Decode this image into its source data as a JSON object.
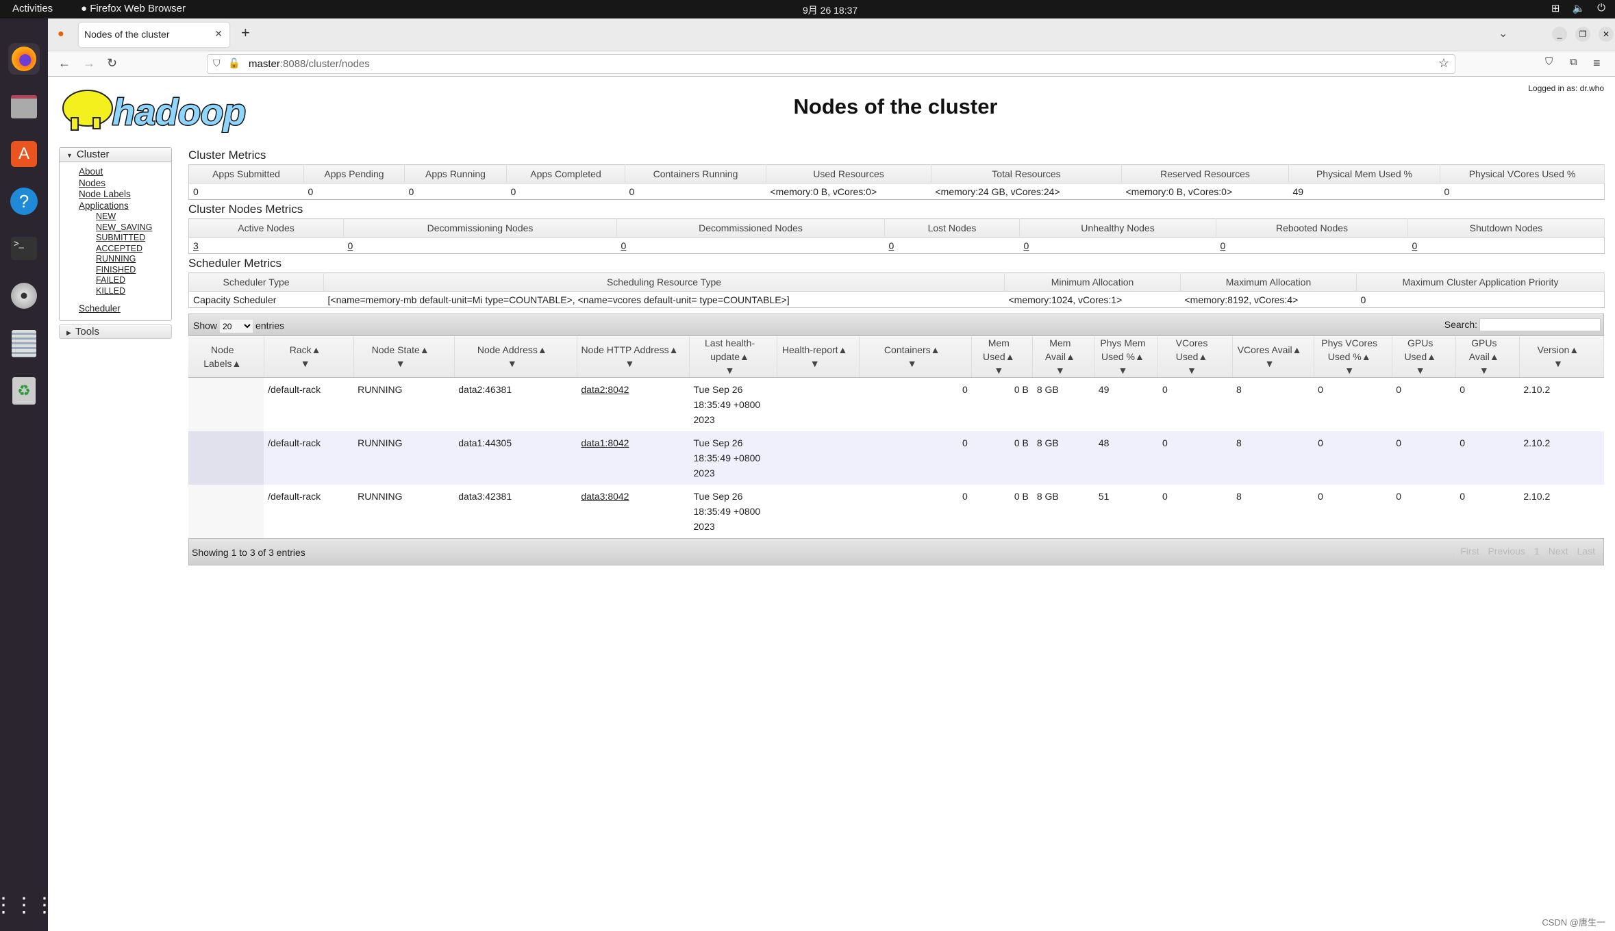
{
  "topbar": {
    "activities": "Activities",
    "app": "Firefox Web Browser",
    "clock": "9月 26  18:37"
  },
  "browser": {
    "tab_title": "Nodes of the cluster",
    "url_host": "master",
    "url_path": ":8088/cluster/nodes"
  },
  "page": {
    "title": "Nodes of the cluster",
    "logged_in": "Logged in as: dr.who",
    "logo_text": "hadoop"
  },
  "sidebar": {
    "cluster": "Cluster",
    "links": [
      "About",
      "Nodes",
      "Node Labels",
      "Applications"
    ],
    "app_states": [
      "NEW",
      "NEW_SAVING",
      "SUBMITTED",
      "ACCEPTED",
      "RUNNING",
      "FINISHED",
      "FAILED",
      "KILLED"
    ],
    "scheduler": "Scheduler",
    "tools": "Tools"
  },
  "cluster_metrics": {
    "heading": "Cluster Metrics",
    "headers": [
      "Apps Submitted",
      "Apps Pending",
      "Apps Running",
      "Apps Completed",
      "Containers Running",
      "Used Resources",
      "Total Resources",
      "Reserved Resources",
      "Physical Mem Used %",
      "Physical VCores Used %"
    ],
    "values": [
      "0",
      "0",
      "0",
      "0",
      "0",
      "<memory:0 B, vCores:0>",
      "<memory:24 GB, vCores:24>",
      "<memory:0 B, vCores:0>",
      "49",
      "0"
    ]
  },
  "nodes_metrics": {
    "heading": "Cluster Nodes Metrics",
    "headers": [
      "Active Nodes",
      "Decommissioning Nodes",
      "Decommissioned Nodes",
      "Lost Nodes",
      "Unhealthy Nodes",
      "Rebooted Nodes",
      "Shutdown Nodes"
    ],
    "values": [
      "3",
      "0",
      "0",
      "0",
      "0",
      "0",
      "0"
    ]
  },
  "scheduler_metrics": {
    "heading": "Scheduler Metrics",
    "headers": [
      "Scheduler Type",
      "Scheduling Resource Type",
      "Minimum Allocation",
      "Maximum Allocation",
      "Maximum Cluster Application Priority"
    ],
    "values": [
      "Capacity Scheduler",
      "[<name=memory-mb default-unit=Mi type=COUNTABLE>, <name=vcores default-unit= type=COUNTABLE>]",
      "<memory:1024, vCores:1>",
      "<memory:8192, vCores:4>",
      "0"
    ]
  },
  "table_controls": {
    "show": "Show",
    "entries_value": "20",
    "entries": "entries",
    "search_label": "Search:",
    "search_value": ""
  },
  "nodes_table": {
    "headers": [
      "Node Labels",
      "Rack",
      "Node State",
      "Node Address",
      "Node HTTP Address",
      "Last health-update",
      "Health-report",
      "Containers",
      "Mem Used",
      "Mem Avail",
      "Phys Mem Used %",
      "VCores Used",
      "VCores Avail",
      "Phys VCores Used %",
      "GPUs Used",
      "GPUs Avail",
      "Version"
    ],
    "rows": [
      [
        "",
        "/default-rack",
        "RUNNING",
        "data2:46381",
        "data2:8042",
        "Tue Sep 26 18:35:49 +0800 2023",
        "",
        "0",
        "0 B",
        "8 GB",
        "49",
        "0",
        "8",
        "0",
        "0",
        "0",
        "2.10.2"
      ],
      [
        "",
        "/default-rack",
        "RUNNING",
        "data1:44305",
        "data1:8042",
        "Tue Sep 26 18:35:49 +0800 2023",
        "",
        "0",
        "0 B",
        "8 GB",
        "48",
        "0",
        "8",
        "0",
        "0",
        "0",
        "2.10.2"
      ],
      [
        "",
        "/default-rack",
        "RUNNING",
        "data3:42381",
        "data3:8042",
        "Tue Sep 26 18:35:49 +0800 2023",
        "",
        "0",
        "0 B",
        "8 GB",
        "51",
        "0",
        "8",
        "0",
        "0",
        "0",
        "2.10.2"
      ]
    ],
    "info": "Showing 1 to 3 of 3 entries",
    "pager": [
      "First",
      "Previous",
      "1",
      "Next",
      "Last"
    ]
  },
  "watermark": "CSDN @唐生一"
}
